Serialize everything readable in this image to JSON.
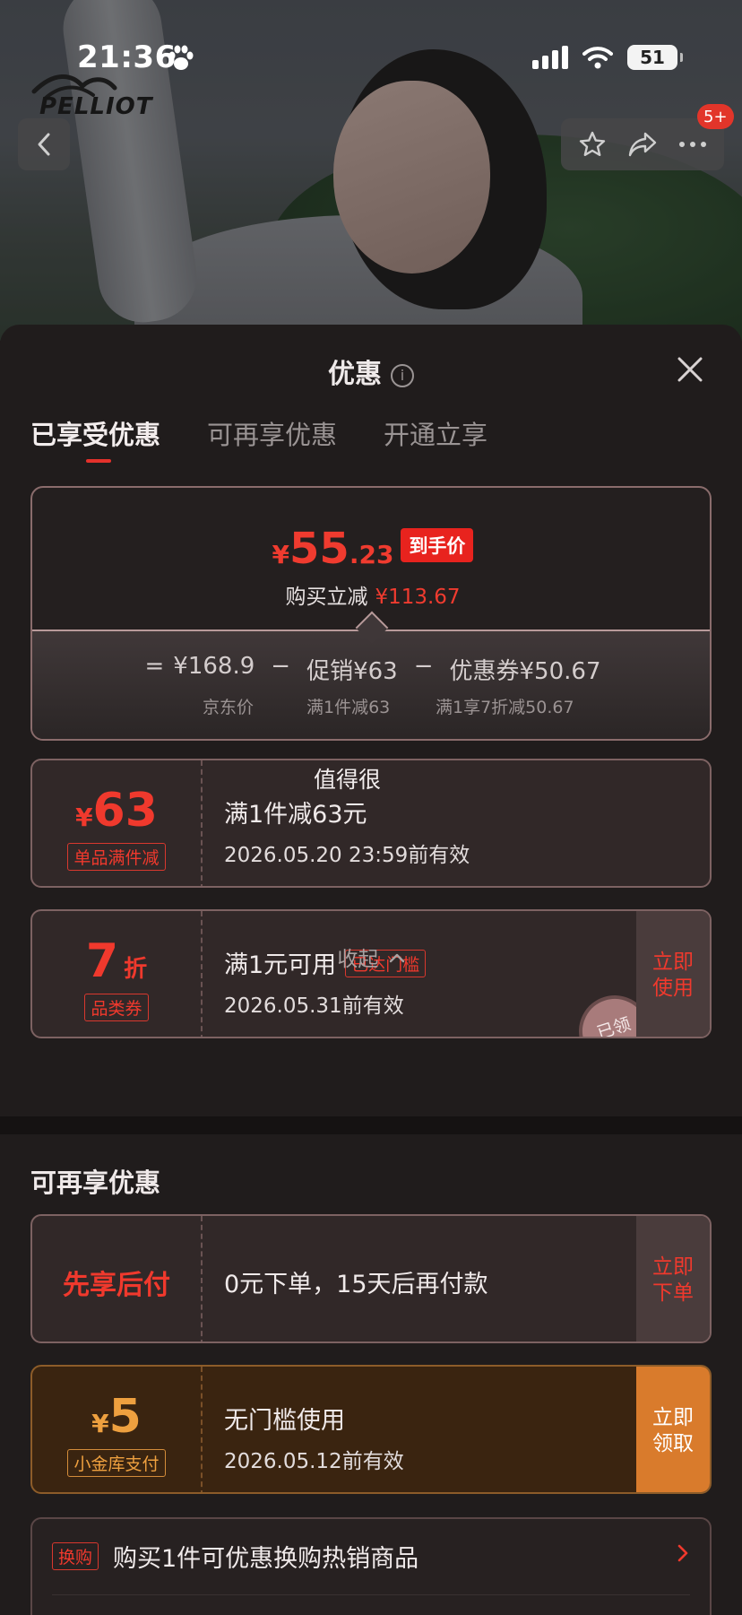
{
  "status_bar": {
    "time": "21:36",
    "battery": "51"
  },
  "brand": {
    "name": "PELLIOT"
  },
  "nav": {
    "badge": "5+"
  },
  "sheet": {
    "title": "优惠",
    "info_glyph": "i",
    "tabs": [
      "已享受优惠",
      "可再享优惠",
      "开通立享"
    ]
  },
  "summary": {
    "currency": "¥",
    "price_int": "55",
    "price_dec": ".23",
    "price_tag": "到手价",
    "save_label": "购买立减",
    "save_amount": "¥113.67",
    "formula": {
      "eq": "=",
      "jd_price": "¥168.9",
      "minus": "−",
      "promo": "促销¥63",
      "coupon": "优惠券¥50.67",
      "jd_label": "京东价",
      "promo_label": "满1件减63",
      "coupon_label": "满1享7折减50.67"
    }
  },
  "coupons": [
    {
      "currency": "¥",
      "amount": "63",
      "badge": "单品满件减",
      "header_text": "值得很",
      "title": "满1件减63元",
      "date": "2026.05.20 23:59前有效"
    },
    {
      "amount": "7",
      "unit": "折",
      "badge": "品类券",
      "title": "满1元可用",
      "reached": "已达门槛",
      "date": "2026.05.31前有效",
      "action": "立即使用",
      "stamp": "已领"
    }
  ],
  "collapse_label": "收起",
  "more_section": {
    "title": "可再享优惠",
    "paylater": {
      "label": "先享后付",
      "title": "0元下单，15天后再付款",
      "action": "立即下单"
    },
    "gold": {
      "currency": "¥",
      "amount": "5",
      "badge": "小金库支付",
      "title": "无门槛使用",
      "date": "2026.05.12前有效",
      "action": "立即领取"
    },
    "swap": {
      "tag": "换购",
      "text": "购买1件可优惠换购热销商品"
    }
  },
  "colors": {
    "accent_red": "#f0392d",
    "gold": "#d97b2c",
    "sheet_bg": "#201c1c"
  }
}
